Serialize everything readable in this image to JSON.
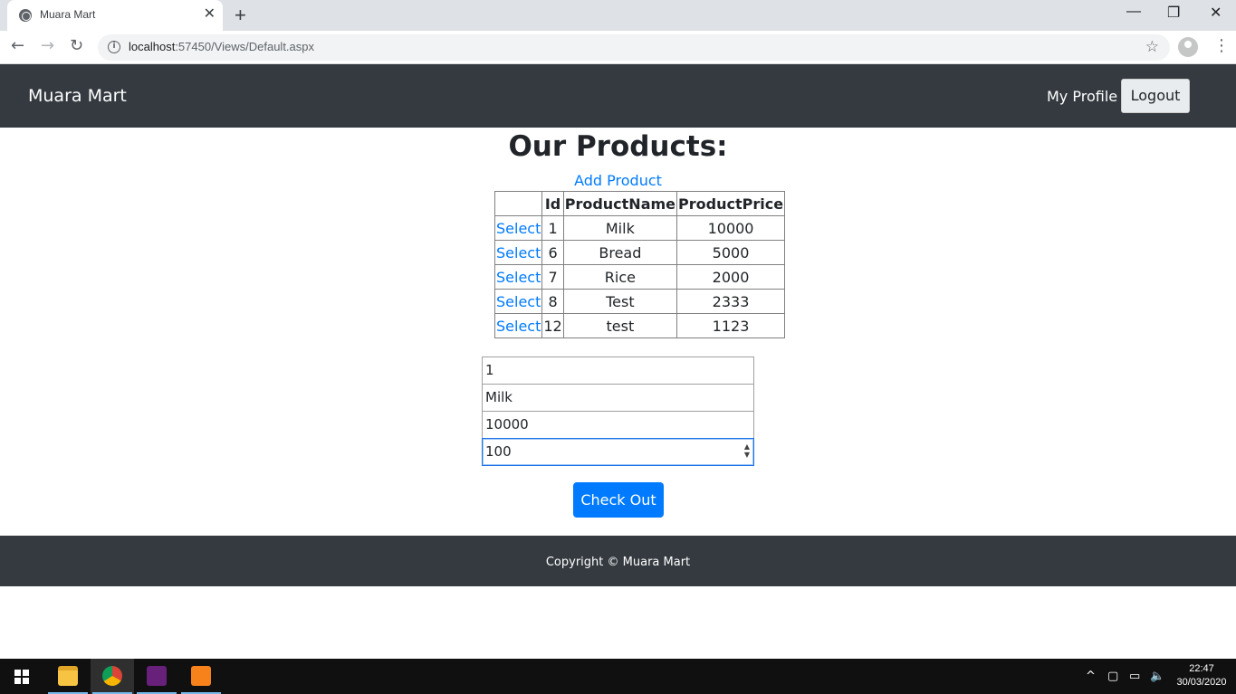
{
  "browser": {
    "tab_title": "Muara Mart",
    "tab_close": "✕",
    "new_tab": "+",
    "url_host": "localhost",
    "url_rest": ":57450/Views/Default.aspx",
    "window_controls": {
      "minimize": "—",
      "restore": "❐",
      "close": "✕"
    }
  },
  "navbar": {
    "brand": "Muara Mart",
    "my_profile": "My Profile",
    "logout": "Logout"
  },
  "main": {
    "heading": "Our Products:",
    "add_product": "Add Product",
    "table": {
      "headers": [
        "",
        "Id",
        "ProductName",
        "ProductPrice"
      ],
      "rows": [
        {
          "action": "Select",
          "id": "1",
          "name": "Milk",
          "price": "10000"
        },
        {
          "action": "Select",
          "id": "6",
          "name": "Bread",
          "price": "5000"
        },
        {
          "action": "Select",
          "id": "7",
          "name": "Rice",
          "price": "2000"
        },
        {
          "action": "Select",
          "id": "8",
          "name": "Test",
          "price": "2333"
        },
        {
          "action": "Select",
          "id": "12",
          "name": "test",
          "price": "1123"
        }
      ]
    },
    "form": {
      "id_value": "1",
      "name_value": "Milk",
      "price_value": "10000",
      "qty_value": "100"
    },
    "checkout": "Check Out"
  },
  "footer": {
    "copyright": "Copyright © Muara Mart"
  },
  "taskbar": {
    "time": "22:47",
    "date": "30/03/2020",
    "apps": [
      "file-explorer-icon",
      "chrome-icon",
      "visual-studio-icon",
      "pdf-icon"
    ]
  },
  "colors": {
    "navbar": "#343a40",
    "link": "#007bff",
    "primary_button": "#007bff"
  }
}
